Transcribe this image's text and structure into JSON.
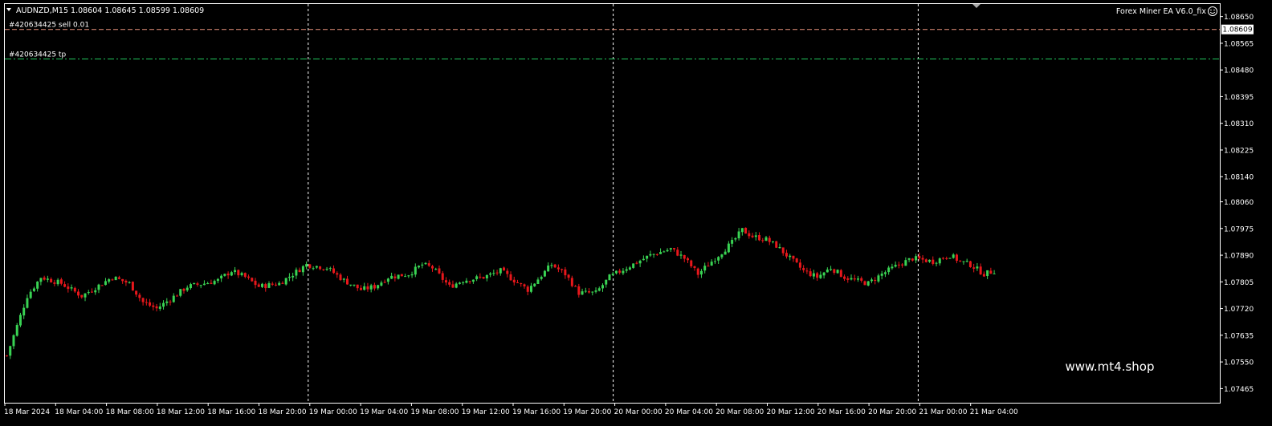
{
  "header": {
    "symbol_line": "AUDNZD,M15  1.08604 1.08645 1.08599 1.08609",
    "ea_label": "Forex Miner EA  V6.0_fix"
  },
  "orders": [
    {
      "label": "#420634425 sell 0.01",
      "price": 1.08609,
      "color": "#e8927c",
      "style": "dash"
    },
    {
      "label": "#420634425 tp",
      "price": 1.08515,
      "color": "#22c55e",
      "style": "dashdot"
    }
  ],
  "current_price": "1.08609",
  "watermark": "www.mt4.shop",
  "colors": {
    "bull": "#39d353",
    "bear": "#e8171b",
    "axis": "#ffffff",
    "grid": "#ffffff"
  },
  "chart_data": {
    "type": "candlestick",
    "symbol": "AUDNZD",
    "timeframe": "M15",
    "ylim": [
      1.0742,
      1.0869
    ],
    "y_ticks": [
      "1.08650",
      "1.08565",
      "1.08480",
      "1.08395",
      "1.08310",
      "1.08225",
      "1.08140",
      "1.08060",
      "1.07975",
      "1.07890",
      "1.07805",
      "1.07720",
      "1.07635",
      "1.07550",
      "1.07465"
    ],
    "x_ticks": [
      "18 Mar 2024",
      "18 Mar 04:00",
      "18 Mar 08:00",
      "18 Mar 12:00",
      "18 Mar 16:00",
      "18 Mar 20:00",
      "19 Mar 00:00",
      "19 Mar 04:00",
      "19 Mar 08:00",
      "19 Mar 12:00",
      "19 Mar 16:00",
      "19 Mar 20:00",
      "20 Mar 00:00",
      "20 Mar 04:00",
      "20 Mar 08:00",
      "20 Mar 12:00",
      "20 Mar 16:00",
      "20 Mar 20:00",
      "21 Mar 00:00",
      "21 Mar 04:00"
    ],
    "day_separators": [
      "19 Mar 00:00",
      "20 Mar 00:00",
      "21 Mar 00:00"
    ],
    "close_path": [
      [
        0,
        1.0757
      ],
      [
        6,
        1.0776
      ],
      [
        10,
        1.0782
      ],
      [
        16,
        1.078
      ],
      [
        22,
        1.0776
      ],
      [
        28,
        1.078
      ],
      [
        31,
        1.0782
      ],
      [
        36,
        1.078
      ],
      [
        40,
        1.0774
      ],
      [
        44,
        1.0772
      ],
      [
        48,
        1.0775
      ],
      [
        53,
        1.0779
      ],
      [
        58,
        1.078
      ],
      [
        62,
        1.0781
      ],
      [
        66,
        1.0784
      ],
      [
        70,
        1.0782
      ],
      [
        74,
        1.0779
      ],
      [
        80,
        1.078
      ],
      [
        84,
        1.0783
      ],
      [
        88,
        1.0786
      ],
      [
        94,
        1.0785
      ],
      [
        99,
        1.0781
      ],
      [
        104,
        1.0778
      ],
      [
        108,
        1.0779
      ],
      [
        112,
        1.0782
      ],
      [
        118,
        1.0783
      ],
      [
        122,
        1.0786
      ],
      [
        125,
        1.0785
      ],
      [
        130,
        1.0779
      ],
      [
        134,
        1.0781
      ],
      [
        140,
        1.0782
      ],
      [
        145,
        1.0784
      ],
      [
        149,
        1.0781
      ],
      [
        153,
        1.0778
      ],
      [
        160,
        1.0786
      ],
      [
        164,
        1.0783
      ],
      [
        168,
        1.0777
      ],
      [
        173,
        1.0777
      ],
      [
        177,
        1.0782
      ],
      [
        182,
        1.0785
      ],
      [
        189,
        1.0789
      ],
      [
        195,
        1.0791
      ],
      [
        199,
        1.0788
      ],
      [
        203,
        1.0783
      ],
      [
        207,
        1.0787
      ],
      [
        210,
        1.079
      ],
      [
        213,
        1.0793
      ],
      [
        216,
        1.0797
      ],
      [
        219,
        1.0795
      ],
      [
        223,
        1.0794
      ],
      [
        226,
        1.0792
      ],
      [
        230,
        1.0788
      ],
      [
        234,
        1.0784
      ],
      [
        238,
        1.0782
      ],
      [
        242,
        1.0785
      ],
      [
        246,
        1.0782
      ],
      [
        249,
        1.0781
      ],
      [
        253,
        1.078
      ],
      [
        257,
        1.0783
      ],
      [
        262,
        1.0786
      ],
      [
        266,
        1.0788
      ],
      [
        272,
        1.0787
      ],
      [
        277,
        1.0789
      ],
      [
        280,
        1.0787
      ],
      [
        283,
        1.0786
      ],
      [
        287,
        1.0783
      ],
      [
        290,
        1.0784
      ]
    ]
  }
}
